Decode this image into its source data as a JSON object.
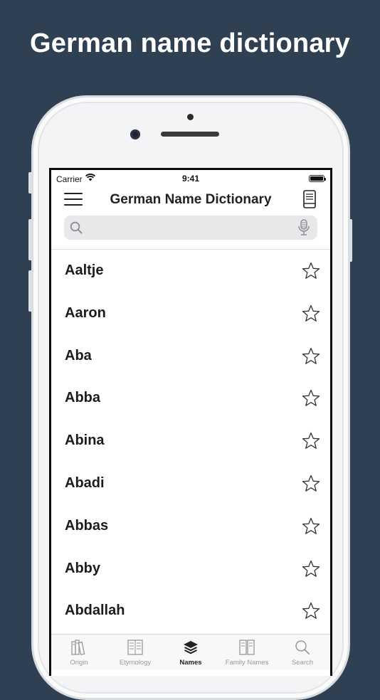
{
  "headline": "German name dictionary",
  "status_bar": {
    "carrier": "Carrier",
    "time": "9:41"
  },
  "nav": {
    "title": "German Name Dictionary"
  },
  "search": {
    "value": "",
    "placeholder": ""
  },
  "names": [
    "Aaltje",
    "Aaron",
    "Aba",
    "Abba",
    "Abina",
    "Abadi",
    "Abbas",
    "Abby",
    "Abdallah"
  ],
  "tabs": [
    {
      "label": "Origin",
      "icon": "books-icon",
      "active": false
    },
    {
      "label": "Etymology",
      "icon": "document-icon",
      "active": false
    },
    {
      "label": "Names",
      "icon": "layers-icon",
      "active": true
    },
    {
      "label": "Family Names",
      "icon": "bookshelf-icon",
      "active": false
    },
    {
      "label": "Search",
      "icon": "search-icon",
      "active": false
    }
  ],
  "colors": {
    "background": "#2f4053",
    "active_tab": "#222222",
    "inactive_tab": "#9a9a9a"
  }
}
